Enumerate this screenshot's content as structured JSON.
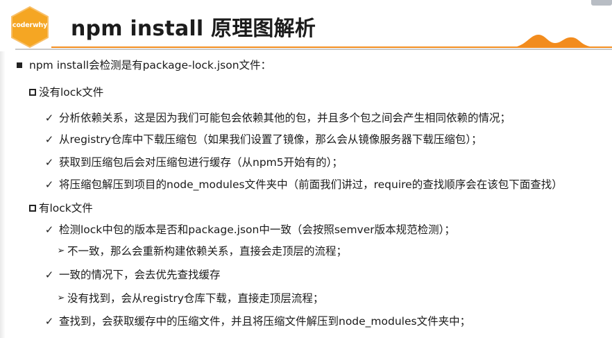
{
  "colors": {
    "badge": "#f5a623",
    "accent": "#f28c1e",
    "title": "#1c1c1c",
    "rule": "#c8c8c8"
  },
  "header": {
    "badge_text": "coderwhy",
    "title": "npm install 原理图解析"
  },
  "content": {
    "lines": [
      {
        "level": 0,
        "marker": "square-filled-icon",
        "text": "npm install会检测是有package-lock.json文件："
      },
      {
        "level": 1,
        "marker": "square-hollow-icon",
        "text": "没有lock文件"
      },
      {
        "level": 2,
        "marker": "check-icon",
        "text": "分析依赖关系，这是因为我们可能包会依赖其他的包，并且多个包之间会产生相同依赖的情况；"
      },
      {
        "level": 2,
        "marker": "check-icon",
        "text": "从registry仓库中下载压缩包（如果我们设置了镜像，那么会从镜像服务器下载压缩包）；"
      },
      {
        "level": 2,
        "marker": "check-icon",
        "text": "获取到压缩包后会对压缩包进行缓存（从npm5开始有的）；"
      },
      {
        "level": 2,
        "marker": "check-icon",
        "text": "将压缩包解压到项目的node_modules文件夹中（前面我们讲过，require的查找顺序会在该包下面查找）"
      },
      {
        "level": 1,
        "marker": "square-hollow-icon",
        "text": "有lock文件"
      },
      {
        "level": 2,
        "marker": "check-icon",
        "text": "检测lock中包的版本是否和package.json中一致（会按照semver版本规范检测）；"
      },
      {
        "level": 3,
        "marker": "arrow-icon",
        "text": "不一致，那么会重新构建依赖关系，直接会走顶层的流程；"
      },
      {
        "level": 2,
        "marker": "check-icon",
        "text": "一致的情况下，会去优先查找缓存"
      },
      {
        "level": 3,
        "marker": "arrow-icon",
        "text": "没有找到，会从registry仓库下载，直接走顶层流程；"
      },
      {
        "level": 2,
        "marker": "check-icon",
        "text": "查找到，会获取缓存中的压缩文件，并且将压缩文件解压到node_modules文件夹中；"
      }
    ]
  }
}
